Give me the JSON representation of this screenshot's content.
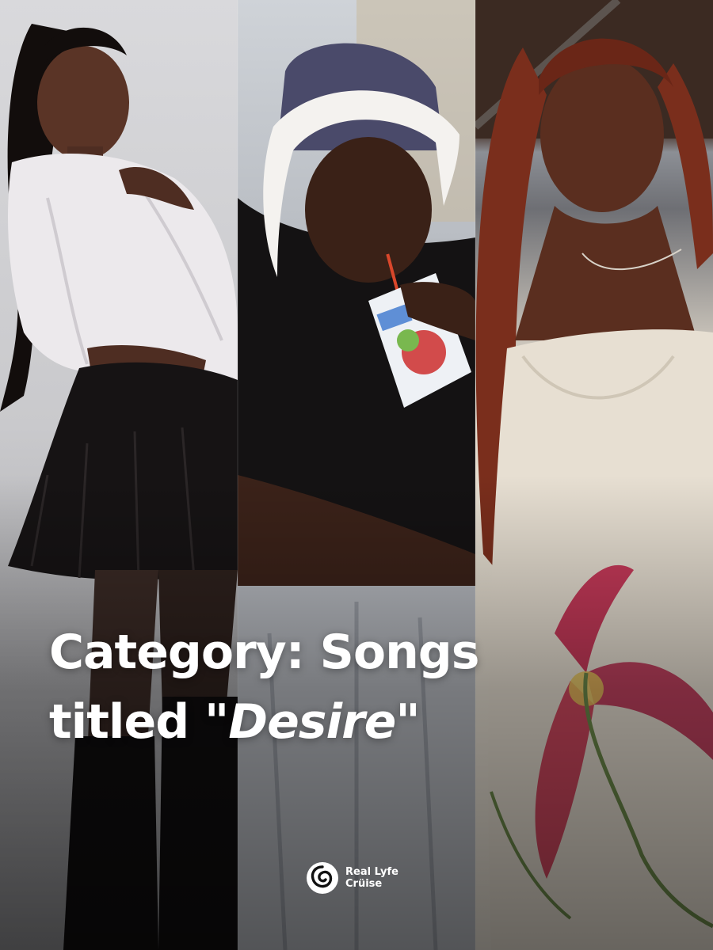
{
  "headline": {
    "line1": "Category: Songs",
    "line2_prefix": "titled \"",
    "line2_italic": "Desire",
    "line2_suffix": "\""
  },
  "brand": {
    "name_line1": "Real Lyfe",
    "name_line2": "Crüise",
    "logo_icon": "swirl-logo-icon"
  },
  "colors": {
    "headline_text": "#ffffff",
    "brand_text": "#ffffff"
  }
}
